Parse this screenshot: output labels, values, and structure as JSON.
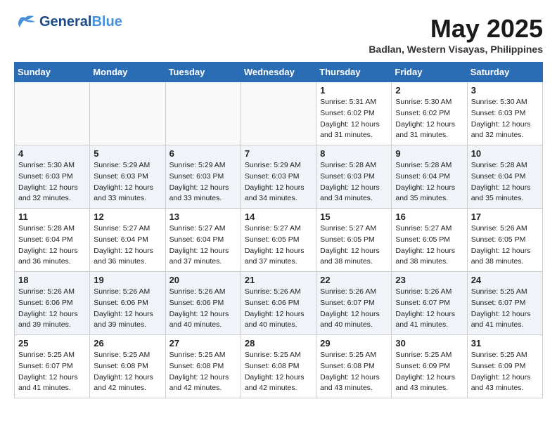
{
  "header": {
    "logo_general": "General",
    "logo_blue": "Blue",
    "month_title": "May 2025",
    "location": "Badlan, Western Visayas, Philippines"
  },
  "weekdays": [
    "Sunday",
    "Monday",
    "Tuesday",
    "Wednesday",
    "Thursday",
    "Friday",
    "Saturday"
  ],
  "weeks": [
    [
      {
        "day": "",
        "sunrise": "",
        "sunset": "",
        "daylight": ""
      },
      {
        "day": "",
        "sunrise": "",
        "sunset": "",
        "daylight": ""
      },
      {
        "day": "",
        "sunrise": "",
        "sunset": "",
        "daylight": ""
      },
      {
        "day": "",
        "sunrise": "",
        "sunset": "",
        "daylight": ""
      },
      {
        "day": "1",
        "sunrise": "Sunrise: 5:31 AM",
        "sunset": "Sunset: 6:02 PM",
        "daylight": "Daylight: 12 hours and 31 minutes."
      },
      {
        "day": "2",
        "sunrise": "Sunrise: 5:30 AM",
        "sunset": "Sunset: 6:02 PM",
        "daylight": "Daylight: 12 hours and 31 minutes."
      },
      {
        "day": "3",
        "sunrise": "Sunrise: 5:30 AM",
        "sunset": "Sunset: 6:03 PM",
        "daylight": "Daylight: 12 hours and 32 minutes."
      }
    ],
    [
      {
        "day": "4",
        "sunrise": "Sunrise: 5:30 AM",
        "sunset": "Sunset: 6:03 PM",
        "daylight": "Daylight: 12 hours and 32 minutes."
      },
      {
        "day": "5",
        "sunrise": "Sunrise: 5:29 AM",
        "sunset": "Sunset: 6:03 PM",
        "daylight": "Daylight: 12 hours and 33 minutes."
      },
      {
        "day": "6",
        "sunrise": "Sunrise: 5:29 AM",
        "sunset": "Sunset: 6:03 PM",
        "daylight": "Daylight: 12 hours and 33 minutes."
      },
      {
        "day": "7",
        "sunrise": "Sunrise: 5:29 AM",
        "sunset": "Sunset: 6:03 PM",
        "daylight": "Daylight: 12 hours and 34 minutes."
      },
      {
        "day": "8",
        "sunrise": "Sunrise: 5:28 AM",
        "sunset": "Sunset: 6:03 PM",
        "daylight": "Daylight: 12 hours and 34 minutes."
      },
      {
        "day": "9",
        "sunrise": "Sunrise: 5:28 AM",
        "sunset": "Sunset: 6:04 PM",
        "daylight": "Daylight: 12 hours and 35 minutes."
      },
      {
        "day": "10",
        "sunrise": "Sunrise: 5:28 AM",
        "sunset": "Sunset: 6:04 PM",
        "daylight": "Daylight: 12 hours and 35 minutes."
      }
    ],
    [
      {
        "day": "11",
        "sunrise": "Sunrise: 5:28 AM",
        "sunset": "Sunset: 6:04 PM",
        "daylight": "Daylight: 12 hours and 36 minutes."
      },
      {
        "day": "12",
        "sunrise": "Sunrise: 5:27 AM",
        "sunset": "Sunset: 6:04 PM",
        "daylight": "Daylight: 12 hours and 36 minutes."
      },
      {
        "day": "13",
        "sunrise": "Sunrise: 5:27 AM",
        "sunset": "Sunset: 6:04 PM",
        "daylight": "Daylight: 12 hours and 37 minutes."
      },
      {
        "day": "14",
        "sunrise": "Sunrise: 5:27 AM",
        "sunset": "Sunset: 6:05 PM",
        "daylight": "Daylight: 12 hours and 37 minutes."
      },
      {
        "day": "15",
        "sunrise": "Sunrise: 5:27 AM",
        "sunset": "Sunset: 6:05 PM",
        "daylight": "Daylight: 12 hours and 38 minutes."
      },
      {
        "day": "16",
        "sunrise": "Sunrise: 5:27 AM",
        "sunset": "Sunset: 6:05 PM",
        "daylight": "Daylight: 12 hours and 38 minutes."
      },
      {
        "day": "17",
        "sunrise": "Sunrise: 5:26 AM",
        "sunset": "Sunset: 6:05 PM",
        "daylight": "Daylight: 12 hours and 38 minutes."
      }
    ],
    [
      {
        "day": "18",
        "sunrise": "Sunrise: 5:26 AM",
        "sunset": "Sunset: 6:06 PM",
        "daylight": "Daylight: 12 hours and 39 minutes."
      },
      {
        "day": "19",
        "sunrise": "Sunrise: 5:26 AM",
        "sunset": "Sunset: 6:06 PM",
        "daylight": "Daylight: 12 hours and 39 minutes."
      },
      {
        "day": "20",
        "sunrise": "Sunrise: 5:26 AM",
        "sunset": "Sunset: 6:06 PM",
        "daylight": "Daylight: 12 hours and 40 minutes."
      },
      {
        "day": "21",
        "sunrise": "Sunrise: 5:26 AM",
        "sunset": "Sunset: 6:06 PM",
        "daylight": "Daylight: 12 hours and 40 minutes."
      },
      {
        "day": "22",
        "sunrise": "Sunrise: 5:26 AM",
        "sunset": "Sunset: 6:07 PM",
        "daylight": "Daylight: 12 hours and 40 minutes."
      },
      {
        "day": "23",
        "sunrise": "Sunrise: 5:26 AM",
        "sunset": "Sunset: 6:07 PM",
        "daylight": "Daylight: 12 hours and 41 minutes."
      },
      {
        "day": "24",
        "sunrise": "Sunrise: 5:25 AM",
        "sunset": "Sunset: 6:07 PM",
        "daylight": "Daylight: 12 hours and 41 minutes."
      }
    ],
    [
      {
        "day": "25",
        "sunrise": "Sunrise: 5:25 AM",
        "sunset": "Sunset: 6:07 PM",
        "daylight": "Daylight: 12 hours and 41 minutes."
      },
      {
        "day": "26",
        "sunrise": "Sunrise: 5:25 AM",
        "sunset": "Sunset: 6:08 PM",
        "daylight": "Daylight: 12 hours and 42 minutes."
      },
      {
        "day": "27",
        "sunrise": "Sunrise: 5:25 AM",
        "sunset": "Sunset: 6:08 PM",
        "daylight": "Daylight: 12 hours and 42 minutes."
      },
      {
        "day": "28",
        "sunrise": "Sunrise: 5:25 AM",
        "sunset": "Sunset: 6:08 PM",
        "daylight": "Daylight: 12 hours and 42 minutes."
      },
      {
        "day": "29",
        "sunrise": "Sunrise: 5:25 AM",
        "sunset": "Sunset: 6:08 PM",
        "daylight": "Daylight: 12 hours and 43 minutes."
      },
      {
        "day": "30",
        "sunrise": "Sunrise: 5:25 AM",
        "sunset": "Sunset: 6:09 PM",
        "daylight": "Daylight: 12 hours and 43 minutes."
      },
      {
        "day": "31",
        "sunrise": "Sunrise: 5:25 AM",
        "sunset": "Sunset: 6:09 PM",
        "daylight": "Daylight: 12 hours and 43 minutes."
      }
    ]
  ]
}
